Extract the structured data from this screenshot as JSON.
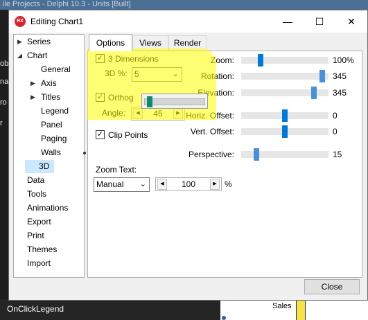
{
  "ide": {
    "top_text": "ile  Projects - Delphi 10.3 - Units [Built]",
    "left_fragments": [
      "ob",
      "na",
      "ro",
      "r"
    ],
    "bottom_label": "OnClickLegend",
    "chart_fragment": "Sales"
  },
  "dialog": {
    "icon_text": "RX",
    "title": "Editing Chart1",
    "minimize": "—",
    "maximize": "☐",
    "close": "✕",
    "close_button": "Close"
  },
  "tree": [
    {
      "label": "Series",
      "arrow": "▶",
      "selected": false
    },
    {
      "label": "Chart",
      "arrow": "◢",
      "selected": false
    },
    {
      "label": "General",
      "arrow": "",
      "selected": false
    },
    {
      "label": "Axis",
      "arrow": "▶",
      "selected": false
    },
    {
      "label": "Titles",
      "arrow": "▶",
      "selected": false
    },
    {
      "label": "Legend",
      "arrow": "",
      "selected": false
    },
    {
      "label": "Panel",
      "arrow": "",
      "selected": false
    },
    {
      "label": "Paging",
      "arrow": "",
      "selected": false
    },
    {
      "label": "Walls",
      "arrow": "",
      "selected": false
    },
    {
      "label": "3D",
      "arrow": "",
      "selected": true
    },
    {
      "label": "Data",
      "arrow": "",
      "selected": false
    },
    {
      "label": "Tools",
      "arrow": "",
      "selected": false
    },
    {
      "label": "Animations",
      "arrow": "",
      "selected": false
    },
    {
      "label": "Export",
      "arrow": "",
      "selected": false
    },
    {
      "label": "Print",
      "arrow": "",
      "selected": false
    },
    {
      "label": "Themes",
      "arrow": "",
      "selected": false
    },
    {
      "label": "Import",
      "arrow": "",
      "selected": false
    }
  ],
  "tabs": [
    "Options",
    "Views",
    "Render"
  ],
  "options": {
    "three_d_label": "3 Dimensions",
    "three_d_checked": true,
    "three_d_percent_label": "3D %:",
    "three_d_percent_value": "5",
    "three_d_percent_slider_value": 5,
    "ortho_label": "Orthog",
    "ortho_checked": true,
    "angle_label": "Angle:",
    "angle_value": "45",
    "clip_label": "Clip Points",
    "clip_checked": true,
    "zoom_text_label": "Zoom Text:",
    "zoom_text_mode": "Manual",
    "zoom_text_value": "100",
    "zoom_text_unit": "%"
  },
  "sliders": [
    {
      "label": "Zoom:",
      "value": "100%",
      "fraction": 0.2,
      "thumb": "#0078d7"
    },
    {
      "label": "Rotation:",
      "value": "345",
      "fraction": 0.96,
      "thumb": "#4a90d9"
    },
    {
      "label": "Elevation:",
      "value": "345",
      "fraction": 0.86,
      "thumb": "#4a90d9"
    },
    {
      "label": "Horiz. Offset:",
      "value": "0",
      "fraction": 0.5,
      "thumb": "#0078d7"
    },
    {
      "label": "Vert. Offset:",
      "value": "0",
      "fraction": 0.5,
      "thumb": "#0078d7"
    },
    {
      "label": "Perspective:",
      "value": "15",
      "fraction": 0.15,
      "thumb": "#4a90d9"
    }
  ],
  "colors": {
    "highlight": "#ffff00",
    "selection": "#cce8ff",
    "accent": "#0078d7",
    "popup_thumb": "#0f8a6c",
    "app_icon": "#d8262f"
  }
}
